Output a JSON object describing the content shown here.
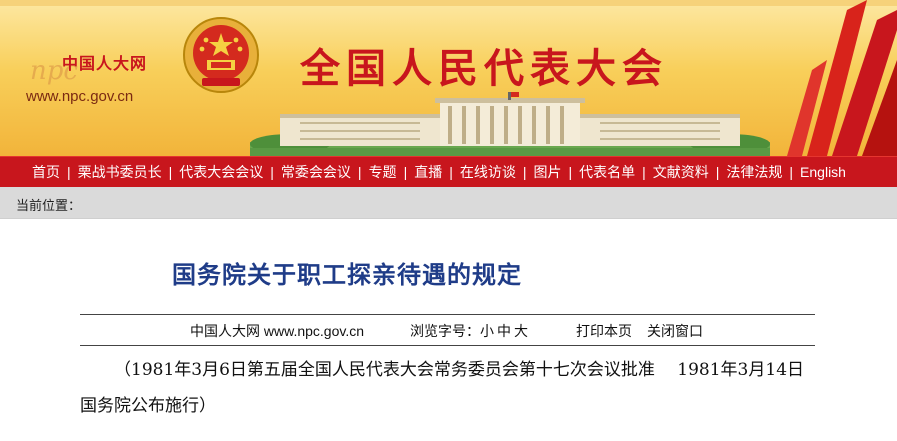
{
  "header": {
    "logo_text": "中国人大网",
    "logo_watermark": "npc",
    "url": "www.npc.gov.cn",
    "site_title": "全国人民代表大会"
  },
  "nav": {
    "items": [
      "首页",
      "栗战书委员长",
      "代表大会会议",
      "常委会会议",
      "专题",
      "直播",
      "在线访谈",
      "图片",
      "代表名单",
      "文献资料",
      "法律法规",
      "English"
    ]
  },
  "location": {
    "label": "当前位置："
  },
  "article": {
    "title": "国务院关于职工探亲待遇的规定",
    "source": "中国人大网 www.npc.gov.cn",
    "font_size_label": "浏览字号：",
    "font_sizes": [
      "小",
      "中",
      "大"
    ],
    "print_label": "打印本页",
    "close_label": "关闭窗口",
    "body": "（1981年3月6日第五届全国人民代表大会常务委员会第十七次会议批准　 1981年3月14日国务院公布施行）"
  },
  "colors": {
    "nav_red": "#c8161d",
    "title_blue": "#1f3c88",
    "banner_gold": "#f8cf5a"
  }
}
